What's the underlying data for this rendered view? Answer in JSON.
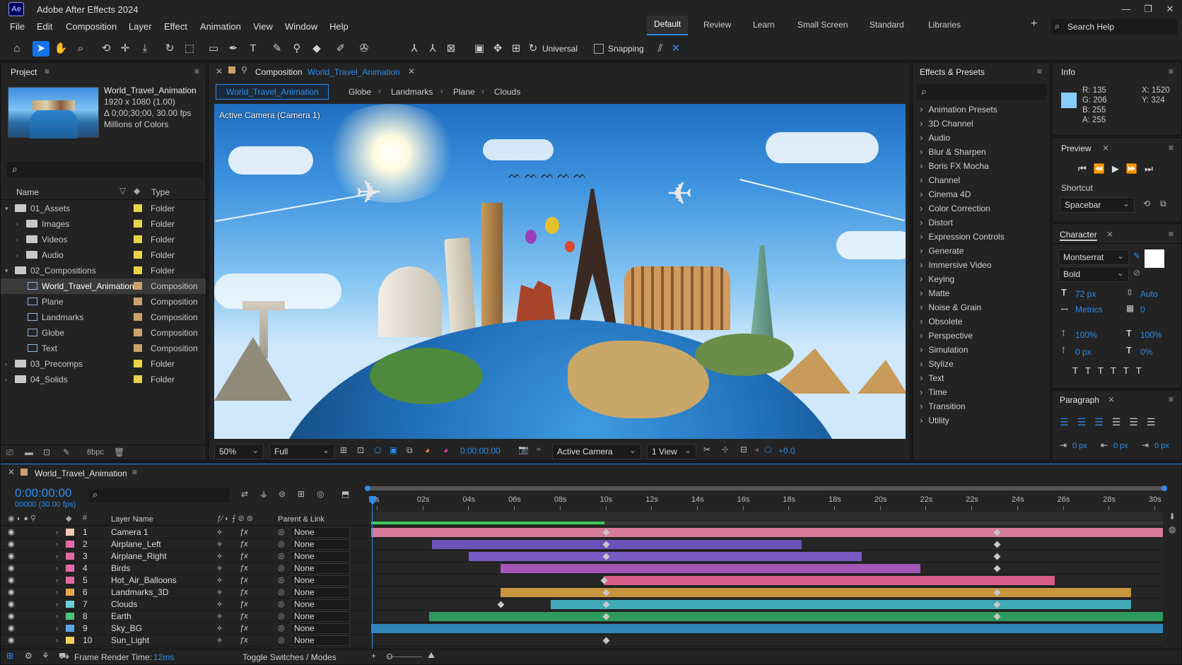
{
  "app": {
    "logo": "Ae",
    "title": "Adobe After Effects 2024"
  },
  "menu": [
    "File",
    "Edit",
    "Composition",
    "Layer",
    "Effect",
    "Animation",
    "View",
    "Window",
    "Help"
  ],
  "workspaces": [
    "Default",
    "Review",
    "Learn",
    "Small Screen",
    "Standard",
    "Libraries"
  ],
  "search_help": "Search Help",
  "toolbar": {
    "universal": "Universal",
    "snapping": "Snapping"
  },
  "project": {
    "title": "Project",
    "comp_name": "World_Travel_Animation",
    "resolution": "1920 x 1080 (1.00)",
    "duration": "Δ 0;00;30;00, 30.00 fps",
    "colors": "Millions of Colors",
    "col_name": "Name",
    "col_type": "Type",
    "items": [
      {
        "name": "01_Assets",
        "type": "Folder",
        "kind": "folder",
        "indent": 0,
        "open": true,
        "color": "#e8d34a"
      },
      {
        "name": "Images",
        "type": "Folder",
        "kind": "folder",
        "indent": 1,
        "open": false,
        "color": "#e8d34a"
      },
      {
        "name": "Videos",
        "type": "Folder",
        "kind": "folder",
        "indent": 1,
        "open": false,
        "color": "#e8d34a"
      },
      {
        "name": "Audio",
        "type": "Folder",
        "kind": "folder",
        "indent": 1,
        "open": false,
        "color": "#e8d34a"
      },
      {
        "name": "02_Compositions",
        "type": "Folder",
        "kind": "folder",
        "indent": 0,
        "open": true,
        "color": "#e8d34a"
      },
      {
        "name": "World_Travel_Animation",
        "type": "Composition",
        "kind": "comp",
        "indent": 1,
        "selected": true,
        "color": "#c9a36b"
      },
      {
        "name": "Plane",
        "type": "Composition",
        "kind": "comp",
        "indent": 1,
        "color": "#c9a36b"
      },
      {
        "name": "Landmarks",
        "type": "Composition",
        "kind": "comp",
        "indent": 1,
        "color": "#c9a36b"
      },
      {
        "name": "Globe",
        "type": "Composition",
        "kind": "comp",
        "indent": 1,
        "color": "#c9a36b"
      },
      {
        "name": "Text",
        "type": "Composition",
        "kind": "comp",
        "indent": 1,
        "color": "#c9a36b"
      },
      {
        "name": "03_Precomps",
        "type": "Folder",
        "kind": "folder",
        "indent": 0,
        "open": false,
        "color": "#e8d34a"
      },
      {
        "name": "04_Solids",
        "type": "Folder",
        "kind": "folder",
        "indent": 0,
        "open": false,
        "color": "#e8d34a"
      }
    ],
    "bpc": "8bpc"
  },
  "comp": {
    "tab_prefix": "Composition",
    "tab_name": "World_Travel_Animation",
    "breadcrumbs": [
      "World_Travel_Animation",
      "Globe",
      "Landmarks",
      "Plane",
      "Clouds"
    ],
    "camera_label": "Active Camera (Camera 1)",
    "zoom": "50%",
    "quality": "Full",
    "timecode": "0:00:00:00",
    "camera": "Active Camera",
    "views": "1 View",
    "exposure": "+0.0"
  },
  "effects": {
    "title": "Effects & Presets",
    "items": [
      "Animation Presets",
      "3D Channel",
      "Audio",
      "Blur & Sharpen",
      "Boris FX Mocha",
      "Channel",
      "Cinema 4D",
      "Color Correction",
      "Distort",
      "Expression Controls",
      "Generate",
      "Immersive Video",
      "Keying",
      "Matte",
      "Noise & Grain",
      "Obsolete",
      "Perspective",
      "Simulation",
      "Stylize",
      "Text",
      "Time",
      "Transition",
      "Utility"
    ]
  },
  "info": {
    "title": "Info",
    "r": "R: 135",
    "g": "G: 206",
    "b": "B: 255",
    "a": "A: 255",
    "x": "X: 1520",
    "y": "Y: 324",
    "swatch": "#87ceff"
  },
  "preview": {
    "title": "Preview",
    "shortcut_label": "Shortcut",
    "shortcut": "Spacebar"
  },
  "character": {
    "title": "Character",
    "font": "Montserrat",
    "style": "Bold",
    "size": "72 px",
    "leading": "Auto",
    "kerning": "Metrics",
    "tracking": "0",
    "vscale": "100%",
    "hscale": "100%",
    "baseline": "0 px",
    "tsume": "0%"
  },
  "paragraph": {
    "title": "Paragraph",
    "indent1": "0 px",
    "indent2": "0 px",
    "indent3": "0 px"
  },
  "timeline": {
    "tab": "World_Travel_Animation",
    "timecode": "0:00:00:00",
    "frames": "00000 (30.00 fps)",
    "col_layer": "Layer Name",
    "col_parent": "Parent & Link",
    "ticks": [
      "0s",
      "02s",
      "04s",
      "06s",
      "08s",
      "10s",
      "12s",
      "14s",
      "16s",
      "18s",
      "18s",
      "20s",
      "22s",
      "22s",
      "24s",
      "26s",
      "28s",
      "30s"
    ],
    "layers": [
      {
        "num": "1",
        "name": "Camera 1",
        "color": "#f0c8b8",
        "parent": "None",
        "bar": [
          0,
          30
        ],
        "bar_color": "#d77b9a",
        "kf": [
          8.9,
          23.7
        ]
      },
      {
        "num": "2",
        "name": "Airplane_Left",
        "color": "#e46aa8",
        "parent": "None",
        "bar": [
          2.3,
          16.3
        ],
        "bar_color": "#6a53b8",
        "kf": [
          8.9,
          23.7
        ]
      },
      {
        "num": "3",
        "name": "Airplane_Right",
        "color": "#e46aa8",
        "parent": "None",
        "bar": [
          3.7,
          18.6
        ],
        "bar_color": "#7a5ac4",
        "kf": [
          8.9,
          23.7
        ]
      },
      {
        "num": "4",
        "name": "Birds",
        "color": "#e46aa8",
        "parent": "None",
        "bar": [
          4.9,
          20.8
        ],
        "bar_color": "#a357b8",
        "kf": [
          23.7
        ]
      },
      {
        "num": "5",
        "name": "Hot_Air_Balloons",
        "color": "#e46aa8",
        "parent": "None",
        "bar": [
          8.8,
          25.9
        ],
        "bar_color": "#d85d88",
        "kf": [
          8.8
        ]
      },
      {
        "num": "6",
        "name": "Landmarks_3D",
        "color": "#e8a84a",
        "parent": "None",
        "bar": [
          4.9,
          28.8
        ],
        "bar_color": "#c8943e",
        "kf": [
          8.9,
          23.7
        ]
      },
      {
        "num": "7",
        "name": "Clouds",
        "color": "#6ad0d8",
        "parent": "None",
        "bar": [
          6.8,
          28.8
        ],
        "bar_color": "#3fa9b8",
        "kf": [
          4.9,
          8.9,
          23.7
        ]
      },
      {
        "num": "8",
        "name": "Earth",
        "color": "#4ec27a",
        "parent": "None",
        "bar": [
          2.2,
          30
        ],
        "bar_color": "#2e9a5e",
        "kf": [
          8.9,
          23.7
        ]
      },
      {
        "num": "9",
        "name": "Sky_BG",
        "color": "#5aa6e8",
        "parent": "None",
        "bar": [
          0,
          30
        ],
        "bar_color": "#2f86b8",
        "kf": []
      },
      {
        "num": "10",
        "name": "Sun_Light",
        "color": "#f0d058",
        "parent": "None",
        "bar": null,
        "bar_color": "",
        "kf": [
          8.9
        ]
      }
    ],
    "render_label": "Frame Render Time:",
    "render_time": "12ms",
    "toggle": "Toggle Switches / Modes"
  }
}
